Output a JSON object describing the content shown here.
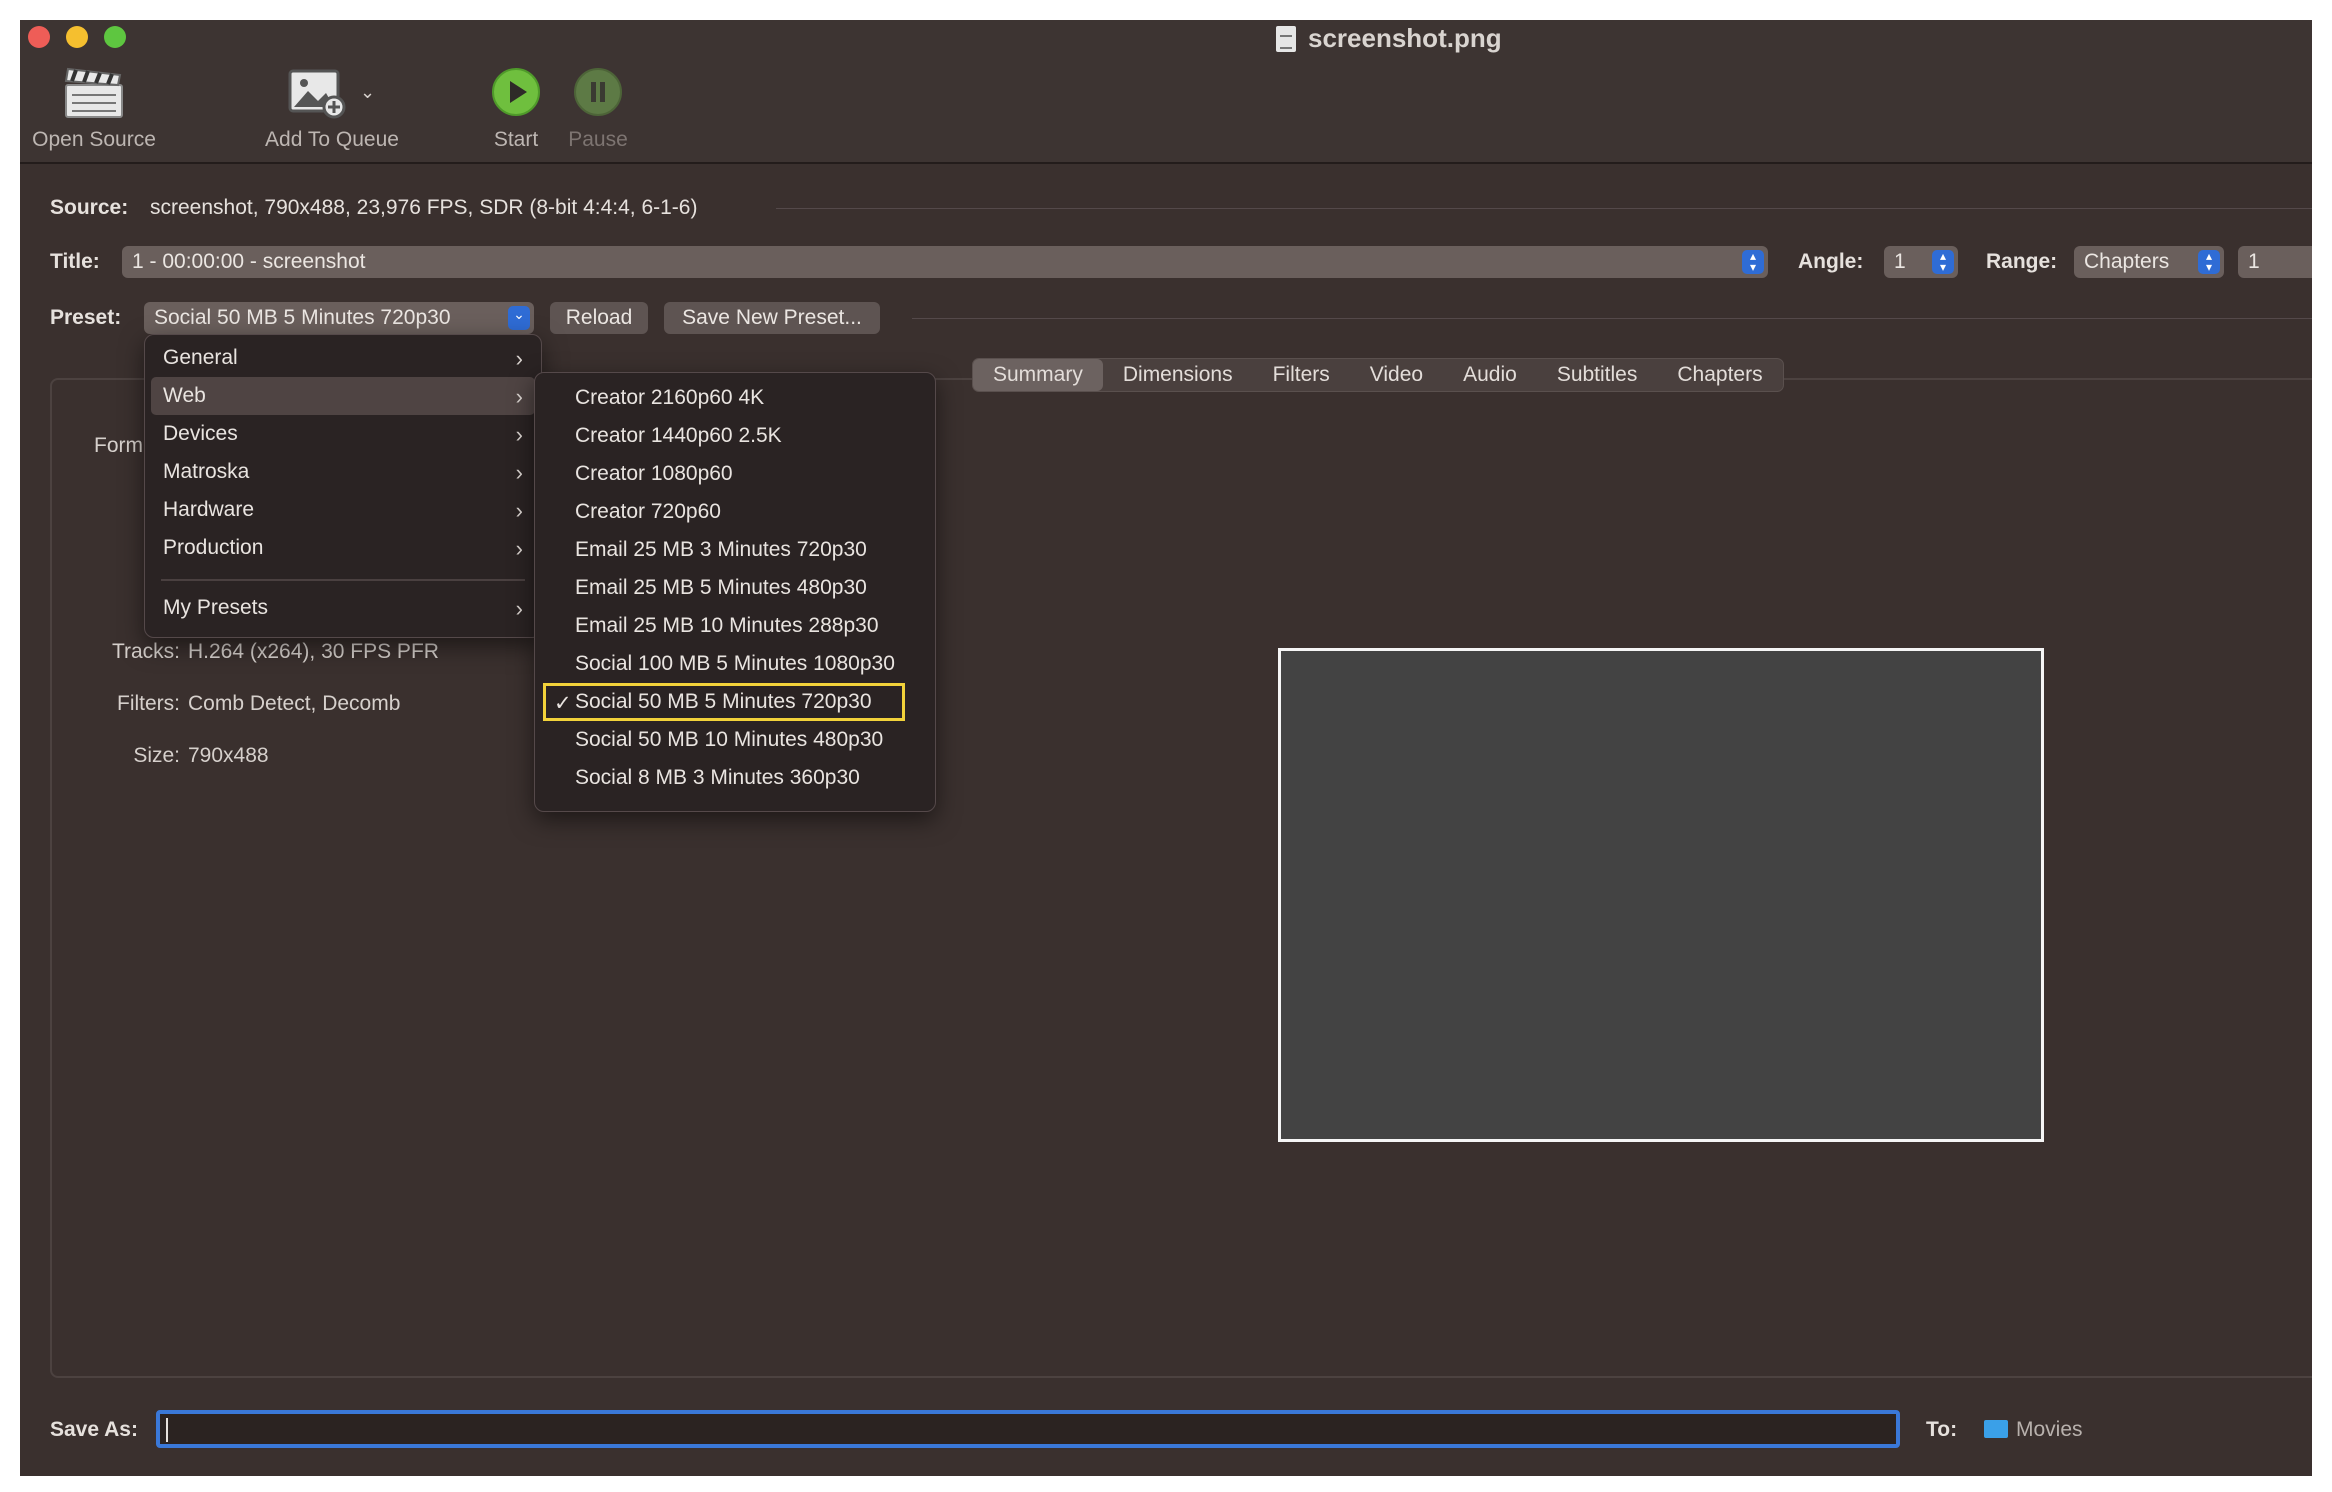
{
  "window": {
    "title": "screenshot.png"
  },
  "toolbar": {
    "open_source": "Open Source",
    "add_to_queue": "Add To Queue",
    "start": "Start",
    "pause": "Pause"
  },
  "source": {
    "label": "Source:",
    "value": "screenshot, 790x488, 23,976 FPS, SDR (8-bit 4:4:4, 6-1-6)"
  },
  "title_row": {
    "label": "Title:",
    "value": "1 - 00:00:00 - screenshot",
    "angle_label": "Angle:",
    "angle_value": "1",
    "range_label": "Range:",
    "range_value": "Chapters",
    "range_start": "1"
  },
  "preset": {
    "label": "Preset:",
    "value": "Social 50 MB 5 Minutes 720p30",
    "reload": "Reload",
    "save_new": "Save New Preset..."
  },
  "tabs": [
    "Summary",
    "Dimensions",
    "Filters",
    "Video",
    "Audio",
    "Subtitles",
    "Chapters"
  ],
  "summary": {
    "format_label": "Form",
    "tracks_label": "Tracks:",
    "tracks_value": "H.264 (x264), 30 FPS PFR",
    "filters_label": "Filters:",
    "filters_value": "Comb Detect, Decomb",
    "size_label": "Size:",
    "size_value": "790x488"
  },
  "preset_menu": {
    "categories": [
      "General",
      "Web",
      "Devices",
      "Matroska",
      "Hardware",
      "Production"
    ],
    "my_presets": "My Presets",
    "web_items": [
      "Creator 2160p60 4K",
      "Creator 1440p60 2.5K",
      "Creator 1080p60",
      "Creator 720p60",
      "Email 25 MB 3 Minutes 720p30",
      "Email 25 MB 5 Minutes 480p30",
      "Email 25 MB 10 Minutes 288p30",
      "Social 100 MB 5 Minutes 1080p30",
      "Social 50 MB 5 Minutes 720p30",
      "Social 50 MB 10 Minutes 480p30",
      "Social 8 MB 3 Minutes 360p30"
    ],
    "check": "✓"
  },
  "save": {
    "label": "Save As:",
    "value": "",
    "to_label": "To:",
    "destination": "Movies"
  },
  "colors": {
    "accent": "#2f6cd5",
    "highlight_border": "#f2d23a",
    "background": "#3a302e"
  }
}
